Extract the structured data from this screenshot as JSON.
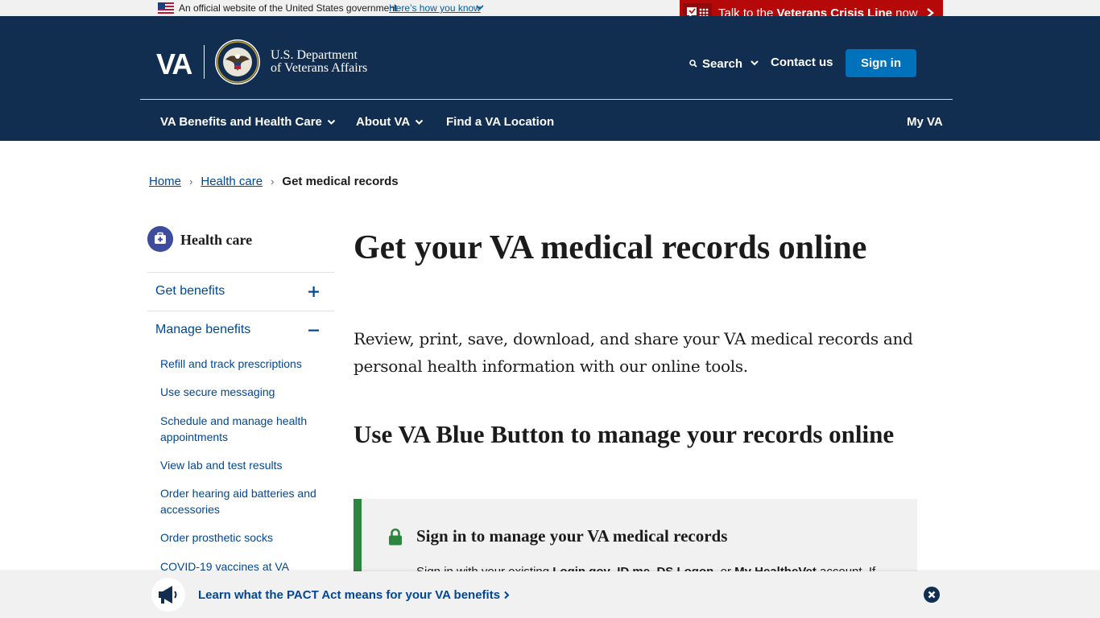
{
  "official_banner": {
    "text": "An official website of the United States government",
    "link": "Here’s how you know"
  },
  "crisis_line": {
    "prefix": "Talk to the ",
    "bold": "Veterans Crisis Line",
    "suffix": " now",
    "color": "#b50909"
  },
  "header": {
    "logo_text": "VA",
    "dept_line1": "U.S. Department",
    "dept_line2": "of Veterans Affairs",
    "search_label": "Search",
    "contact_label": "Contact us",
    "signin_label": "Sign in",
    "bg_color": "#112e51",
    "accent_color": "#0071bb"
  },
  "nav": {
    "benefits": "VA Benefits and Health Care",
    "about": "About VA",
    "find": "Find a VA Location",
    "myva": "My VA"
  },
  "breadcrumb": {
    "home": "Home",
    "health": "Health care",
    "current": "Get medical records"
  },
  "sidebar": {
    "title": "Health care",
    "sections": [
      {
        "label": "Get benefits",
        "expanded": false
      },
      {
        "label": "Manage benefits",
        "expanded": true
      }
    ],
    "links": [
      "Refill and track prescriptions",
      "Use secure messaging",
      "Schedule and manage health appointments",
      "View lab and test results",
      "Order hearing aid batteries and accessories",
      "Order prosthetic socks",
      "COVID-19 vaccines at VA"
    ]
  },
  "main": {
    "title": "Get your VA medical records online",
    "lead": "Review, print, save, download, and share your VA medical records and personal health information with our online tools.",
    "subheading": "Use VA Blue Button to manage your records online",
    "alert": {
      "title": "Sign in to manage your VA medical records",
      "body_start": "Sign in with your existing ",
      "login_gov": "Login.gov",
      "sep1": ", ",
      "id_me": "ID.me",
      "sep2": ", ",
      "ds_logon": "DS Logon",
      "sep3": ", or ",
      "mhv": "My HealtheVet",
      "body_end": " account. If",
      "border_color": "#2e8540"
    }
  },
  "promo": {
    "link": "Learn what the PACT Act means for your VA benefits"
  }
}
